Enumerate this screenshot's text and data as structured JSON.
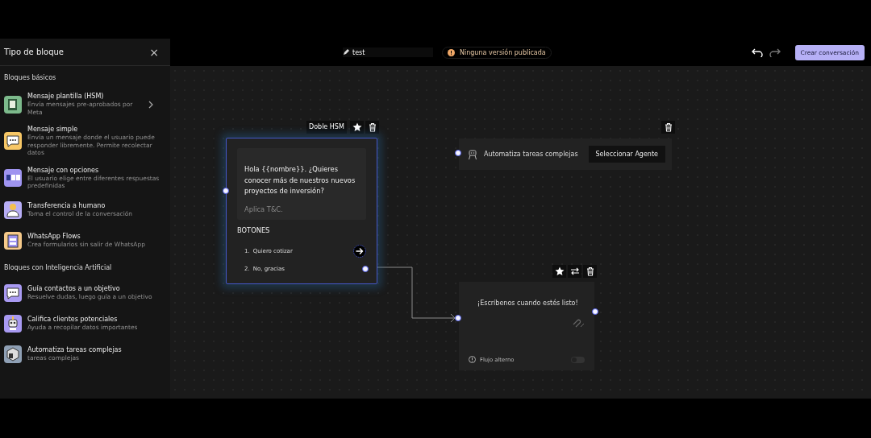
{
  "sidebar": {
    "title": "Tipo de bloque",
    "close": "×",
    "sections": [
      {
        "heading": "Bloques básicos",
        "items": [
          {
            "title": "Mensaje plantilla (HSM)",
            "description": "Envía mensajes pre-aprobados por Meta",
            "color": "#7dba8c",
            "kind": "book",
            "chevron": true
          },
          {
            "title": "Mensaje simple",
            "description": "Envía un mensaje donde el usuario puede responder libremente. Permite recolectar datos",
            "color": "#f7c766",
            "kind": "bubble",
            "chevron": false
          },
          {
            "title": "Mensaje con opciones",
            "description": "El usuario elige entre diferentes respuestas predefinidas",
            "color": "#9f94f0",
            "kind": "options",
            "chevron": false
          },
          {
            "title": "Transferencia a humano",
            "description": "Toma el control de la conversación",
            "color": "#b7adf5",
            "kind": "person",
            "chevron": false
          },
          {
            "title": "WhatsApp Flows",
            "description": "Crea formularios sin salir de WhatsApp",
            "color": "#f5c98a",
            "kind": "form",
            "chevron": false
          }
        ]
      },
      {
        "heading": "Bloques con Inteligencia Artificial",
        "items": [
          {
            "title": "Guía contactos a un objetivo",
            "description": "Resuelve dudas, luego guía a un objetivo",
            "color": "#a99af2",
            "kind": "bubble",
            "chevron": false
          },
          {
            "title": "Califica clientes potenciales",
            "description": "Ayuda a recopilar datos importantes",
            "color": "#a99af2",
            "kind": "robot",
            "chevron": false
          },
          {
            "title": "Automatiza tareas complejas",
            "description": "tareas complejas",
            "color": "#8fa0b5",
            "kind": "box",
            "chevron": false
          }
        ]
      }
    ]
  },
  "topbar": {
    "flow_name": "test",
    "status": "Ninguna versión publicada",
    "undo_enabled": true,
    "redo_enabled": false,
    "primary_button": "Crear conversación"
  },
  "canvas": {
    "hsm_node": {
      "label": "Doble HSM",
      "selected": true,
      "message": "Hola {{nombre}}. ¿Quieres conocer más de nuestros nuevos proyectos de inversión?",
      "footer": "Aplica T&C.",
      "buttons_heading": "BOTONES",
      "buttons": [
        {
          "number": "1.",
          "label": "Quiero cotizar",
          "connected": false
        },
        {
          "number": "2.",
          "label": "No, gracias",
          "connected": true
        }
      ]
    },
    "agent_node": {
      "label": "Automatiza tareas complejas",
      "button": "Seleccionar Agente"
    },
    "message_node": {
      "message": "¡Escríbenos cuando estés listo!",
      "alt_flow_label": "Flujo alterno",
      "alt_flow_on": false
    }
  }
}
